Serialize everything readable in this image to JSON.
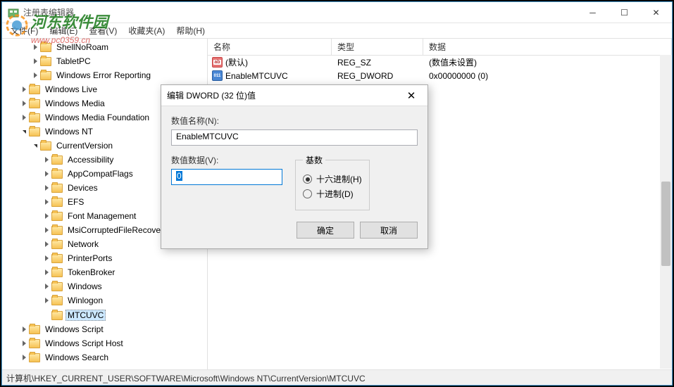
{
  "window": {
    "title": "注册表编辑器"
  },
  "menu": {
    "file": "文件(F)",
    "edit": "编辑(E)",
    "view": "查看(V)",
    "favorites": "收藏夹(A)",
    "help": "帮助(H)"
  },
  "watermark": {
    "text": "河东软件园",
    "url": "www.pc0359.cn"
  },
  "tree": {
    "items": [
      {
        "depth": 2,
        "tw": "closed",
        "label": "ShellNoRoam"
      },
      {
        "depth": 2,
        "tw": "closed",
        "label": "TabletPC"
      },
      {
        "depth": 2,
        "tw": "closed",
        "label": "Windows Error Reporting"
      },
      {
        "depth": 1,
        "tw": "closed",
        "label": "Windows Live"
      },
      {
        "depth": 1,
        "tw": "closed",
        "label": "Windows Media"
      },
      {
        "depth": 1,
        "tw": "closed",
        "label": "Windows Media Foundation"
      },
      {
        "depth": 1,
        "tw": "open2",
        "label": "Windows NT"
      },
      {
        "depth": 2,
        "tw": "open2",
        "label": "CurrentVersion"
      },
      {
        "depth": 3,
        "tw": "closed",
        "label": "Accessibility"
      },
      {
        "depth": 3,
        "tw": "closed",
        "label": "AppCompatFlags"
      },
      {
        "depth": 3,
        "tw": "closed",
        "label": "Devices"
      },
      {
        "depth": 3,
        "tw": "closed",
        "label": "EFS"
      },
      {
        "depth": 3,
        "tw": "closed",
        "label": "Font Management"
      },
      {
        "depth": 3,
        "tw": "closed",
        "label": "MsiCorruptedFileRecovery"
      },
      {
        "depth": 3,
        "tw": "closed",
        "label": "Network"
      },
      {
        "depth": 3,
        "tw": "closed",
        "label": "PrinterPorts"
      },
      {
        "depth": 3,
        "tw": "closed",
        "label": "TokenBroker"
      },
      {
        "depth": 3,
        "tw": "closed",
        "label": "Windows"
      },
      {
        "depth": 3,
        "tw": "closed",
        "label": "Winlogon"
      },
      {
        "depth": 3,
        "tw": "empty",
        "label": "MTCUVC",
        "selected": true
      },
      {
        "depth": 1,
        "tw": "closed",
        "label": "Windows Script"
      },
      {
        "depth": 1,
        "tw": "closed",
        "label": "Windows Script Host"
      },
      {
        "depth": 1,
        "tw": "closed",
        "label": "Windows Search"
      }
    ]
  },
  "list": {
    "headers": {
      "name": "名称",
      "type": "类型",
      "data": "数据"
    },
    "rows": [
      {
        "icon": "sz",
        "name": "(默认)",
        "type": "REG_SZ",
        "data": "(数值未设置)"
      },
      {
        "icon": "dw",
        "name": "EnableMTCUVC",
        "type": "REG_DWORD",
        "data": "0x00000000 (0)"
      }
    ]
  },
  "statusbar": {
    "path": "计算机\\HKEY_CURRENT_USER\\SOFTWARE\\Microsoft\\Windows NT\\CurrentVersion\\MTCUVC"
  },
  "dialog": {
    "title": "编辑 DWORD (32 位)值",
    "name_label": "数值名称(N):",
    "name_value": "EnableMTCUVC",
    "data_label": "数值数据(V):",
    "data_value": "0",
    "base_legend": "基数",
    "radio_hex": "十六进制(H)",
    "radio_dec": "十进制(D)",
    "ok": "确定",
    "cancel": "取消"
  }
}
